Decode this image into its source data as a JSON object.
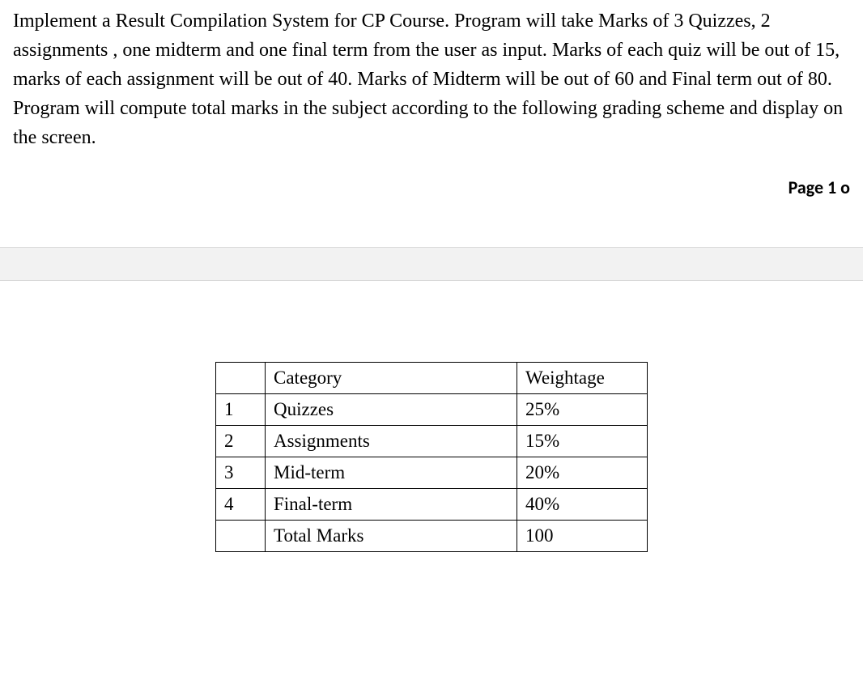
{
  "body_text": "Implement a Result Compilation System for CP Course. Program will take Marks of 3 Quizzes, 2 assignments , one midterm and one final term from the user as input. Marks of each quiz will be out of 15, marks of each assignment will be out of 40. Marks of Midterm will be out of 60 and Final term out of 80. Program will compute total marks in the subject according to the following grading scheme and display on the screen.",
  "page_indicator": "Page 1 o",
  "table": {
    "header": {
      "num": "",
      "category": "Category",
      "weightage": "Weightage"
    },
    "rows": [
      {
        "num": "1",
        "category": "Quizzes",
        "weightage": "25%"
      },
      {
        "num": "2",
        "category": "Assignments",
        "weightage": "15%"
      },
      {
        "num": "3",
        "category": "Mid-term",
        "weightage": "20%"
      },
      {
        "num": "4",
        "category": "Final-term",
        "weightage": "40%"
      },
      {
        "num": "",
        "category": "Total Marks",
        "weightage": "100"
      }
    ]
  }
}
